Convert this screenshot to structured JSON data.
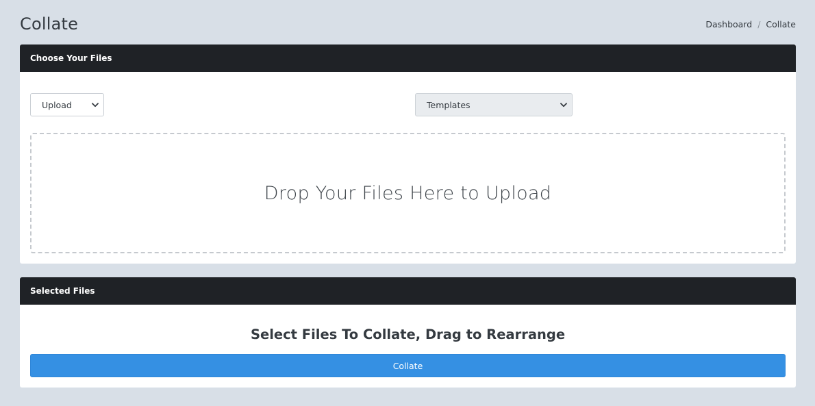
{
  "page": {
    "title": "Collate"
  },
  "breadcrumb": {
    "items": [
      {
        "label": "Dashboard"
      },
      {
        "label": "Collate"
      }
    ],
    "separator": "/"
  },
  "choose_files": {
    "header": "Choose Your Files",
    "source_select": {
      "selected": "Upload",
      "icon": "chevron-down-icon"
    },
    "templates_select": {
      "selected": "Templates",
      "icon": "chevron-down-icon"
    },
    "dropzone_text": "Drop Your Files Here to Upload"
  },
  "selected_files": {
    "header": "Selected Files",
    "heading": "Select Files To Collate, Drag to Rearrange",
    "collate_button": "Collate"
  },
  "colors": {
    "background": "#d8dfe7",
    "card_header": "#1f2226",
    "primary_button": "#3590e3"
  }
}
